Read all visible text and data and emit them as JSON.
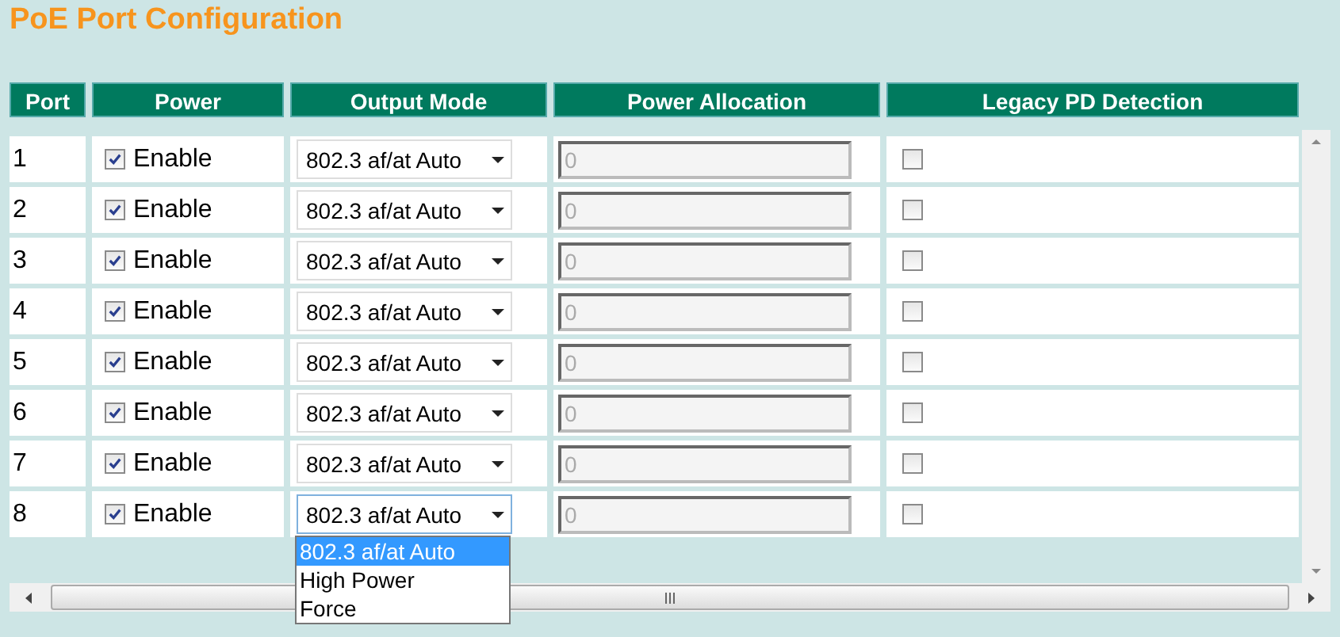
{
  "title": "PoE Port Configuration",
  "table": {
    "columns": [
      "Port",
      "Power",
      "Output Mode",
      "Power Allocation",
      "Legacy PD Detection"
    ],
    "rows": [
      {
        "port": "1",
        "power": {
          "checked": true,
          "label": "Enable"
        },
        "output_mode": {
          "value": "802.3 af/at Auto",
          "expanded": false
        },
        "power_allocation": {
          "value": "0",
          "disabled": true
        },
        "legacy_pd": {
          "checked": false
        }
      },
      {
        "port": "2",
        "power": {
          "checked": true,
          "label": "Enable"
        },
        "output_mode": {
          "value": "802.3 af/at Auto",
          "expanded": false
        },
        "power_allocation": {
          "value": "0",
          "disabled": true
        },
        "legacy_pd": {
          "checked": false
        }
      },
      {
        "port": "3",
        "power": {
          "checked": true,
          "label": "Enable"
        },
        "output_mode": {
          "value": "802.3 af/at Auto",
          "expanded": false
        },
        "power_allocation": {
          "value": "0",
          "disabled": true
        },
        "legacy_pd": {
          "checked": false
        }
      },
      {
        "port": "4",
        "power": {
          "checked": true,
          "label": "Enable"
        },
        "output_mode": {
          "value": "802.3 af/at Auto",
          "expanded": false
        },
        "power_allocation": {
          "value": "0",
          "disabled": true
        },
        "legacy_pd": {
          "checked": false
        }
      },
      {
        "port": "5",
        "power": {
          "checked": true,
          "label": "Enable"
        },
        "output_mode": {
          "value": "802.3 af/at Auto",
          "expanded": false
        },
        "power_allocation": {
          "value": "0",
          "disabled": true
        },
        "legacy_pd": {
          "checked": false
        }
      },
      {
        "port": "6",
        "power": {
          "checked": true,
          "label": "Enable"
        },
        "output_mode": {
          "value": "802.3 af/at Auto",
          "expanded": false
        },
        "power_allocation": {
          "value": "0",
          "disabled": true
        },
        "legacy_pd": {
          "checked": false
        }
      },
      {
        "port": "7",
        "power": {
          "checked": true,
          "label": "Enable"
        },
        "output_mode": {
          "value": "802.3 af/at Auto",
          "expanded": false
        },
        "power_allocation": {
          "value": "0",
          "disabled": true
        },
        "legacy_pd": {
          "checked": false
        }
      },
      {
        "port": "8",
        "power": {
          "checked": true,
          "label": "Enable"
        },
        "output_mode": {
          "value": "802.3 af/at Auto",
          "expanded": true,
          "options": [
            {
              "label": "802.3 af/at Auto",
              "selected": true
            },
            {
              "label": "High Power",
              "selected": false
            },
            {
              "label": "Force",
              "selected": false
            }
          ]
        },
        "power_allocation": {
          "value": "0",
          "disabled": true
        },
        "legacy_pd": {
          "checked": false
        }
      }
    ]
  }
}
